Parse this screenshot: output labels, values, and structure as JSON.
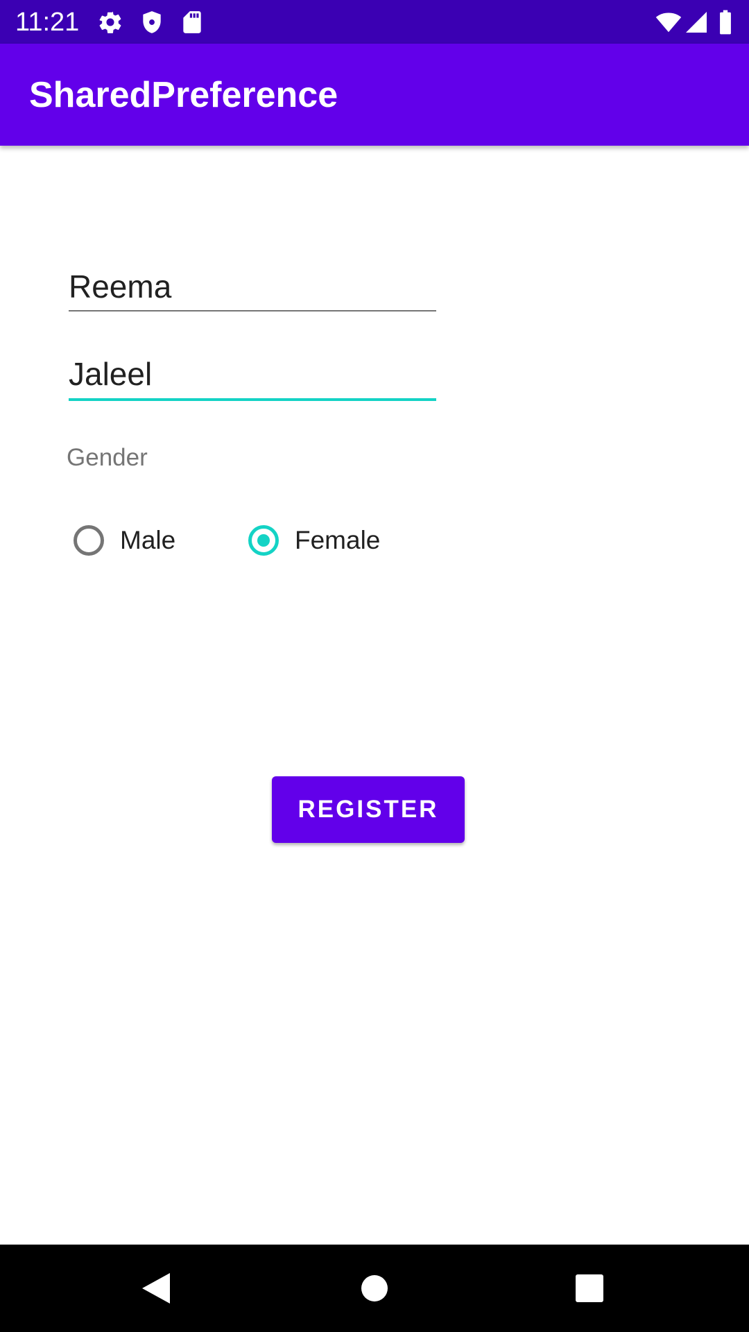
{
  "status_bar": {
    "time": "11:21",
    "icons_left": [
      "settings-icon",
      "shield-icon",
      "sd-card-icon"
    ],
    "icons_right": [
      "wifi-icon",
      "cellular-signal-icon",
      "battery-icon"
    ]
  },
  "app_bar": {
    "title": "SharedPreference"
  },
  "form": {
    "first_name_value": "Reema",
    "last_name_value": "Jaleel",
    "gender_label": "Gender",
    "radio_options": [
      {
        "label": "Male",
        "checked": false
      },
      {
        "label": "Female",
        "checked": true
      }
    ],
    "register_label": "REGISTER"
  },
  "nav_bar": {
    "buttons": [
      "back-icon",
      "home-icon",
      "recents-icon"
    ]
  },
  "colors": {
    "status_bar": "#3b00b3",
    "primary": "#6200ea",
    "accent": "#14d3c5",
    "nav_bar": "#000000"
  }
}
